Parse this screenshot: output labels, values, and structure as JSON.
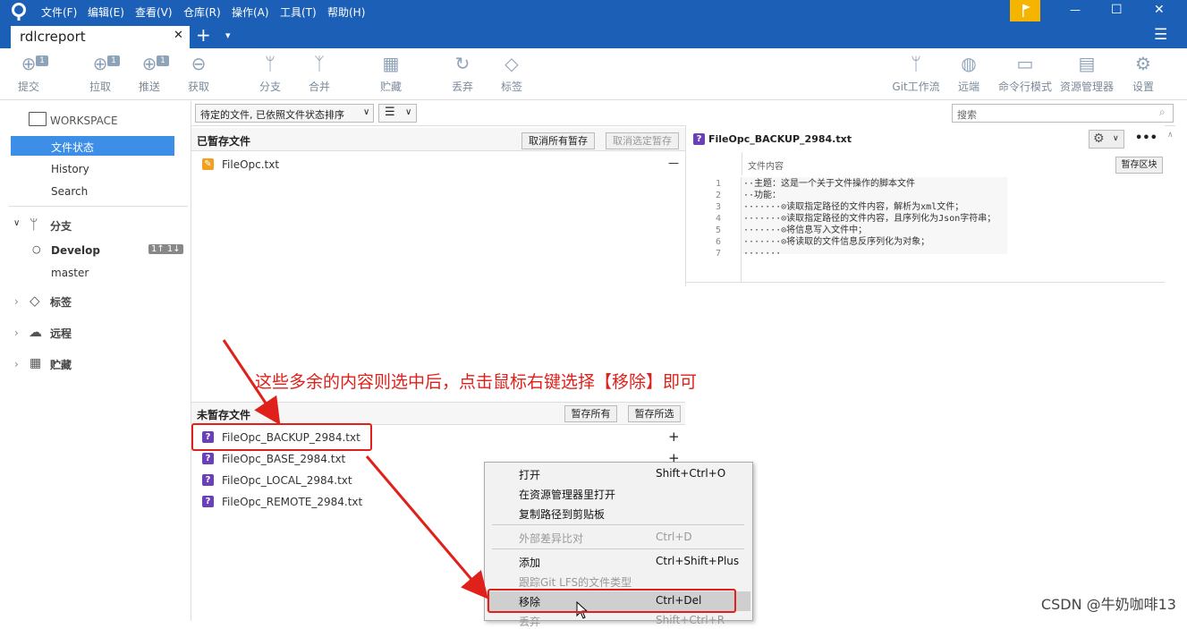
{
  "menubar": {
    "items": [
      "文件(F)",
      "编辑(E)",
      "查看(V)",
      "仓库(R)",
      "操作(A)",
      "工具(T)",
      "帮助(H)"
    ]
  },
  "tabs": {
    "active": "rdlcreport",
    "close": "✕",
    "add": "+",
    "dropdown": "▾",
    "hamburger": "☰"
  },
  "window_controls": {
    "min": "—",
    "max": "☐",
    "close": "✕"
  },
  "toolbar": {
    "items": [
      {
        "label": "提交",
        "badge": "1",
        "icon": "commit-icon"
      },
      {
        "label": "拉取",
        "badge": "1",
        "icon": "pull-icon"
      },
      {
        "label": "推送",
        "badge": "1",
        "icon": "push-icon"
      },
      {
        "label": "获取",
        "badge": "",
        "icon": "fetch-icon"
      },
      {
        "label": "分支",
        "badge": "",
        "icon": "branch-icon"
      },
      {
        "label": "合并",
        "badge": "",
        "icon": "merge-icon"
      },
      {
        "label": "贮藏",
        "badge": "",
        "icon": "stash-icon"
      },
      {
        "label": "丢弃",
        "badge": "",
        "icon": "discard-icon"
      },
      {
        "label": "标签",
        "badge": "",
        "icon": "tag-icon"
      }
    ],
    "right_items": [
      {
        "label": "Git工作流",
        "icon": "gitflow-icon"
      },
      {
        "label": "远端",
        "icon": "remote-icon"
      },
      {
        "label": "命令行模式",
        "icon": "terminal-icon"
      },
      {
        "label": "资源管理器",
        "icon": "explorer-icon"
      },
      {
        "label": "设置",
        "icon": "settings-icon"
      }
    ]
  },
  "sidebar": {
    "workspace": "WORKSPACE",
    "workspace_items": [
      "文件状态",
      "History",
      "Search"
    ],
    "branches_header": "分支",
    "branches": [
      {
        "name": "Develop",
        "badge": "1↑ 1↓"
      },
      {
        "name": "master",
        "badge": ""
      }
    ],
    "tags_header": "标签",
    "remotes_header": "远程",
    "stashes_header": "贮藏"
  },
  "filter": {
    "sort_select": "待定的文件, 已依照文件状态排序",
    "search_placeholder": "搜索"
  },
  "staged": {
    "title": "已暂存文件",
    "unstage_all": "取消所有暂存",
    "unstage_selected": "取消选定暂存",
    "files": [
      {
        "name": "FileOpc.txt",
        "action": "—"
      }
    ]
  },
  "unstaged": {
    "title": "未暂存文件",
    "stage_all": "暂存所有",
    "stage_selected": "暂存所选",
    "files": [
      {
        "name": "FileOpc_BACKUP_2984.txt",
        "action": "+"
      },
      {
        "name": "FileOpc_BASE_2984.txt",
        "action": "+"
      },
      {
        "name": "FileOpc_LOCAL_2984.txt",
        "action": ""
      },
      {
        "name": "FileOpc_REMOTE_2984.txt",
        "action": ""
      }
    ]
  },
  "diff": {
    "filename": "FileOpc_BACKUP_2984.txt",
    "content_label": "文件内容",
    "stage_hunk": "暂存区块",
    "more": "•••",
    "lines": [
      {
        "n": "1",
        "text": "··主题：这是一个关于文件操作的脚本文件"
      },
      {
        "n": "2",
        "text": "··功能："
      },
      {
        "n": "3",
        "text": "·······⊙读取指定路径的文件内容，解析为xml文件；"
      },
      {
        "n": "4",
        "text": "·······⊙读取指定路径的文件内容，且序列化为Json字符串；"
      },
      {
        "n": "5",
        "text": "·······⊙将信息写入文件中；"
      },
      {
        "n": "6",
        "text": "·······⊙将读取的文件信息反序列化为对象；"
      },
      {
        "n": "7",
        "text": "·······"
      }
    ]
  },
  "context_menu": {
    "items": [
      {
        "label": "打开",
        "shortcut": "Shift+Ctrl+O",
        "disabled": false
      },
      {
        "label": "在资源管理器里打开",
        "shortcut": "",
        "disabled": false
      },
      {
        "label": "复制路径到剪贴板",
        "shortcut": "",
        "disabled": false
      },
      {
        "label": "外部差异比对",
        "shortcut": "Ctrl+D",
        "disabled": true
      },
      {
        "label": "添加",
        "shortcut": "Ctrl+Shift+Plus",
        "disabled": false
      },
      {
        "label": "跟踪Git LFS的文件类型",
        "shortcut": "",
        "disabled": true
      },
      {
        "label": "移除",
        "shortcut": "Ctrl+Del",
        "disabled": false
      },
      {
        "label": "丢弃",
        "shortcut": "Shift+Ctrl+R",
        "disabled": true
      }
    ]
  },
  "annotation": {
    "text": "这些多余的内容则选中后，点击鼠标右键选择【移除】即可"
  },
  "watermark": "CSDN @牛奶咖啡13",
  "colors": {
    "titlebar": "#1c5fb6",
    "accent": "#e0201a",
    "selection": "#3d8ee6",
    "flag": "#f5b400"
  }
}
